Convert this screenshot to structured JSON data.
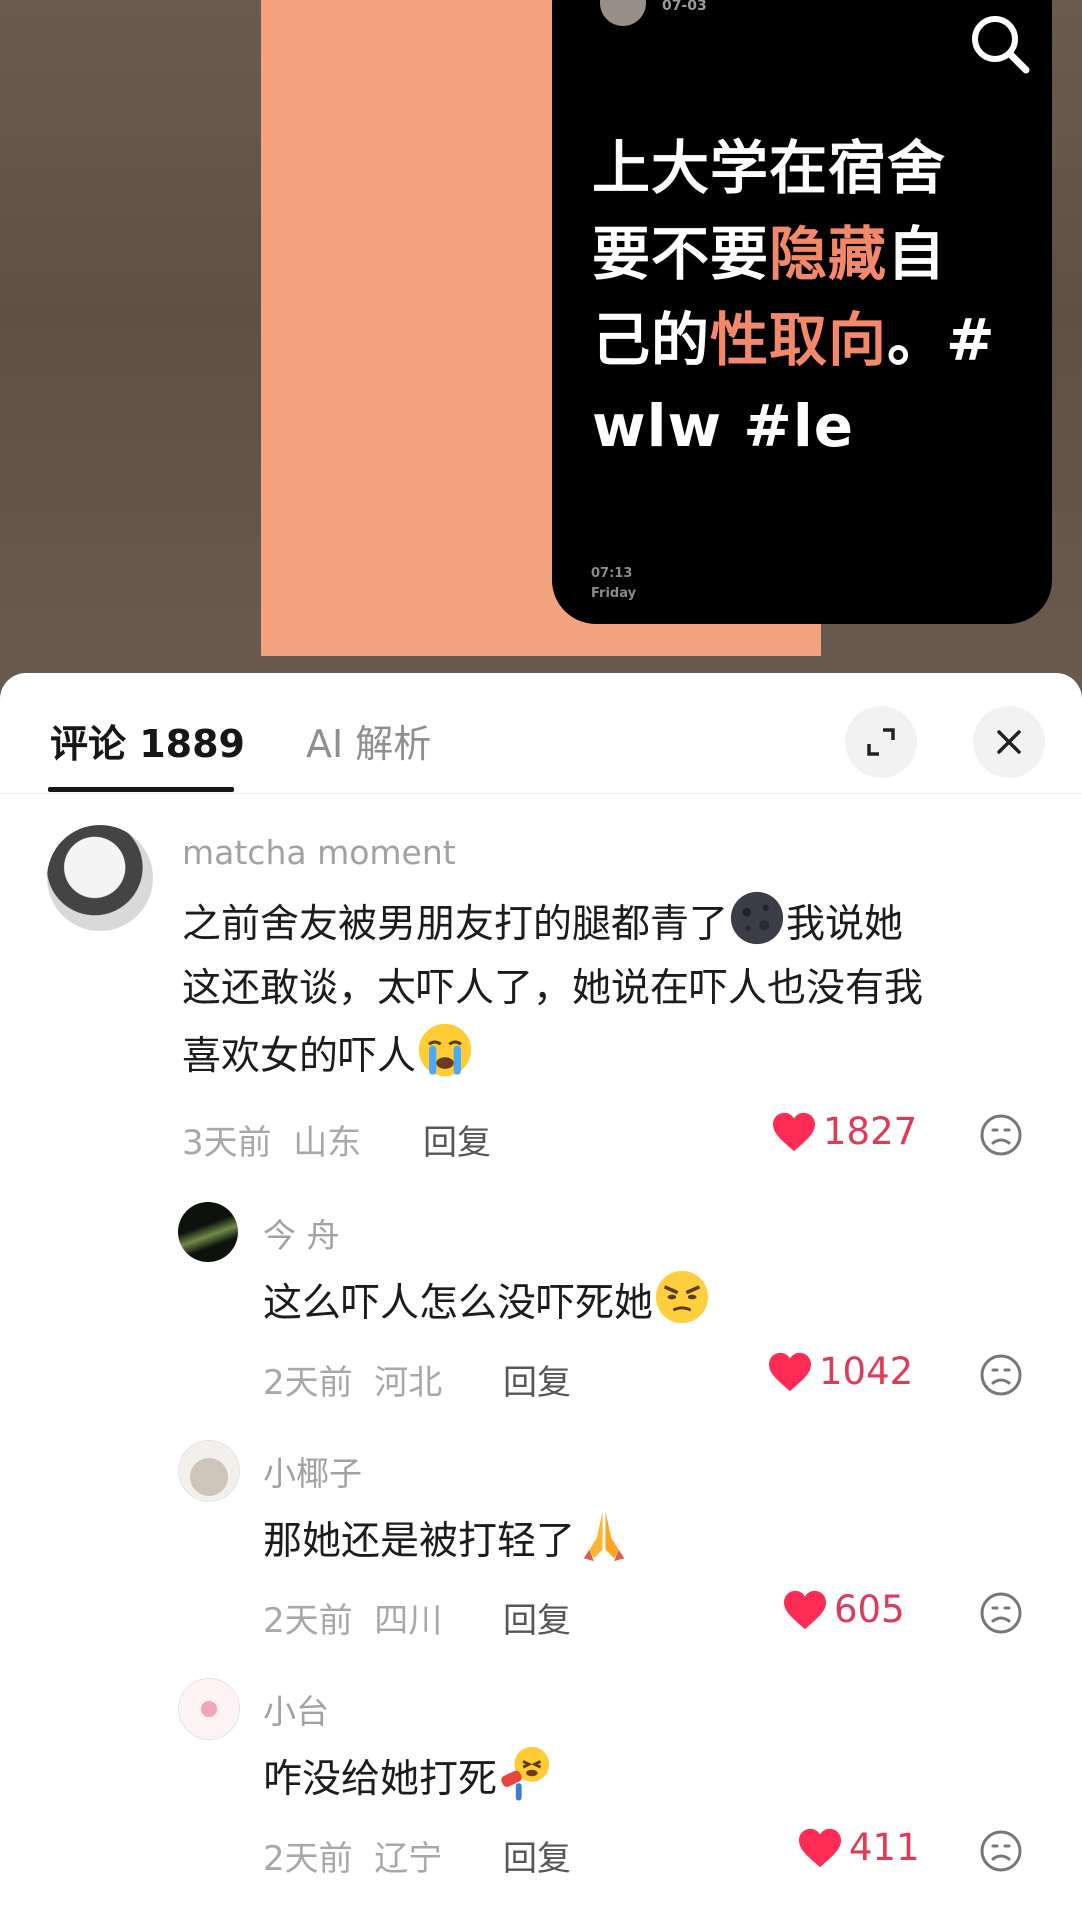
{
  "video": {
    "post_date": "07-03",
    "caption_lines": [
      [
        {
          "t": "上大学在宿舍",
          "hl": false
        }
      ],
      [
        {
          "t": "要不要",
          "hl": false
        },
        {
          "t": "隐藏",
          "hl": true
        },
        {
          "t": "自",
          "hl": false
        }
      ],
      [
        {
          "t": "己的",
          "hl": false
        },
        {
          "t": "性取向",
          "hl": true
        },
        {
          "t": "。#",
          "hl": false
        }
      ],
      [
        {
          "t": "wlw #le",
          "hl": false
        }
      ]
    ],
    "time": "07:13",
    "weekday": "Friday"
  },
  "sheet": {
    "tab_comments": "评论 1889",
    "tab_ai": "AI 解析"
  },
  "comments": [
    {
      "user": "matcha moment",
      "text_parts": [
        "之前舍友被男朋友打的腿都青了",
        "[moon]",
        "我说她",
        "\n",
        "这还敢谈，太吓人了，她说在吓人也没有我",
        "\n",
        "喜欢女的吓人",
        "[cry]"
      ],
      "time": "3天前",
      "location": "山东",
      "reply": "回复",
      "likes": "1827"
    },
    {
      "user": "今 舟",
      "text_parts": [
        "这么吓人怎么没吓死她",
        "[angry]"
      ],
      "time": "2天前",
      "location": "河北",
      "reply": "回复",
      "likes": "1042"
    },
    {
      "user": "小椰子",
      "text_parts": [
        "那她还是被打轻了",
        "[pray]"
      ],
      "time": "2天前",
      "location": "四川",
      "reply": "回复",
      "likes": "605"
    },
    {
      "user": "小台",
      "text_parts": [
        "咋没给她打死",
        "[hit]"
      ],
      "time": "2天前",
      "location": "辽宁",
      "reply": "回复",
      "likes": "411"
    }
  ],
  "colors": {
    "accent_like": "#fe2c55",
    "highlight": "#f4896a",
    "frame": "#f3a27e"
  }
}
